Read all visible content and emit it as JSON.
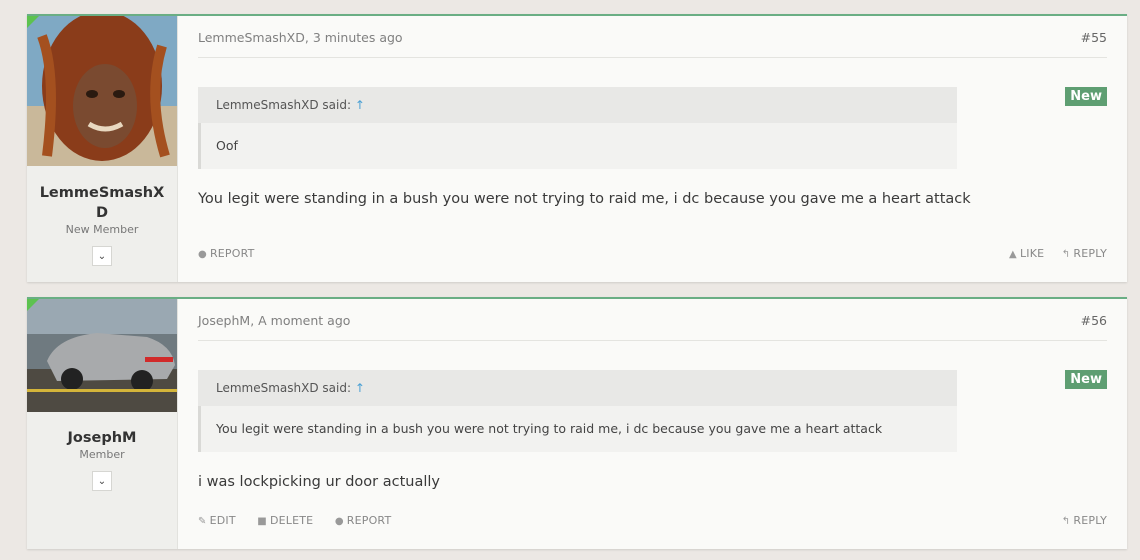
{
  "posts": [
    {
      "username": "LemmeSmashXD",
      "user_title": "New Member",
      "meta_author": "LemmeSmashXD",
      "meta_time": "3 minutes ago",
      "post_number": "#55",
      "new_badge": "New",
      "quote_author": "LemmeSmashXD said:",
      "quote_arrow": "↑",
      "quote_text": "Oof",
      "message": "You legit were standing in a bush you were not trying to raid me, i dc because you gave me a heart attack",
      "actions_left": [
        "REPORT"
      ],
      "actions_right": [
        "LIKE",
        "REPLY"
      ]
    },
    {
      "username": "JosephM",
      "user_title": "Member",
      "meta_author": "JosephM",
      "meta_time": "A moment ago",
      "post_number": "#56",
      "new_badge": "New",
      "quote_author": "LemmeSmashXD said:",
      "quote_arrow": "↑",
      "quote_text": "You legit were standing in a bush you were not trying to raid me, i dc because you gave me a heart attack",
      "message": "i was lockpicking ur door actually",
      "actions_left": [
        "EDIT",
        "DELETE",
        "REPORT"
      ],
      "actions_right": [
        "REPLY"
      ]
    }
  ],
  "colors": {
    "accent_border": "#6aae84",
    "new_badge": "#5e9e72",
    "online_corner": "#5dc24f",
    "quote_arrow": "#4aa0d4"
  },
  "icons": {
    "report": "report-icon",
    "like": "thumbs-up-icon",
    "reply": "reply-icon",
    "edit": "pencil-icon",
    "delete": "trash-icon",
    "dropdown": "chevron-down-icon"
  }
}
